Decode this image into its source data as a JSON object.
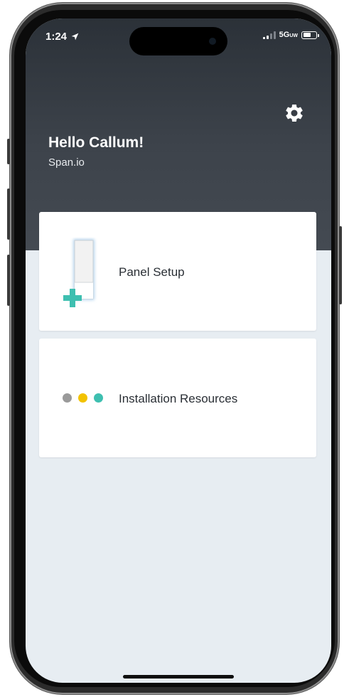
{
  "status_bar": {
    "time": "1:24",
    "network": "5G",
    "network_sub": "UW"
  },
  "header": {
    "greeting": "Hello Callum!",
    "organization": "Span.io"
  },
  "cards": [
    {
      "label": "Panel Setup",
      "icon": "panel-plus-icon"
    },
    {
      "label": "Installation Resources",
      "icon": "three-dots-icon"
    }
  ],
  "colors": {
    "header_dark": "#2b3138",
    "background": "#e7edf2",
    "accent_teal": "#3ebfb0",
    "dot_gray": "#9a9a9a",
    "dot_yellow": "#f2c200",
    "dot_teal": "#3ebfb0"
  }
}
